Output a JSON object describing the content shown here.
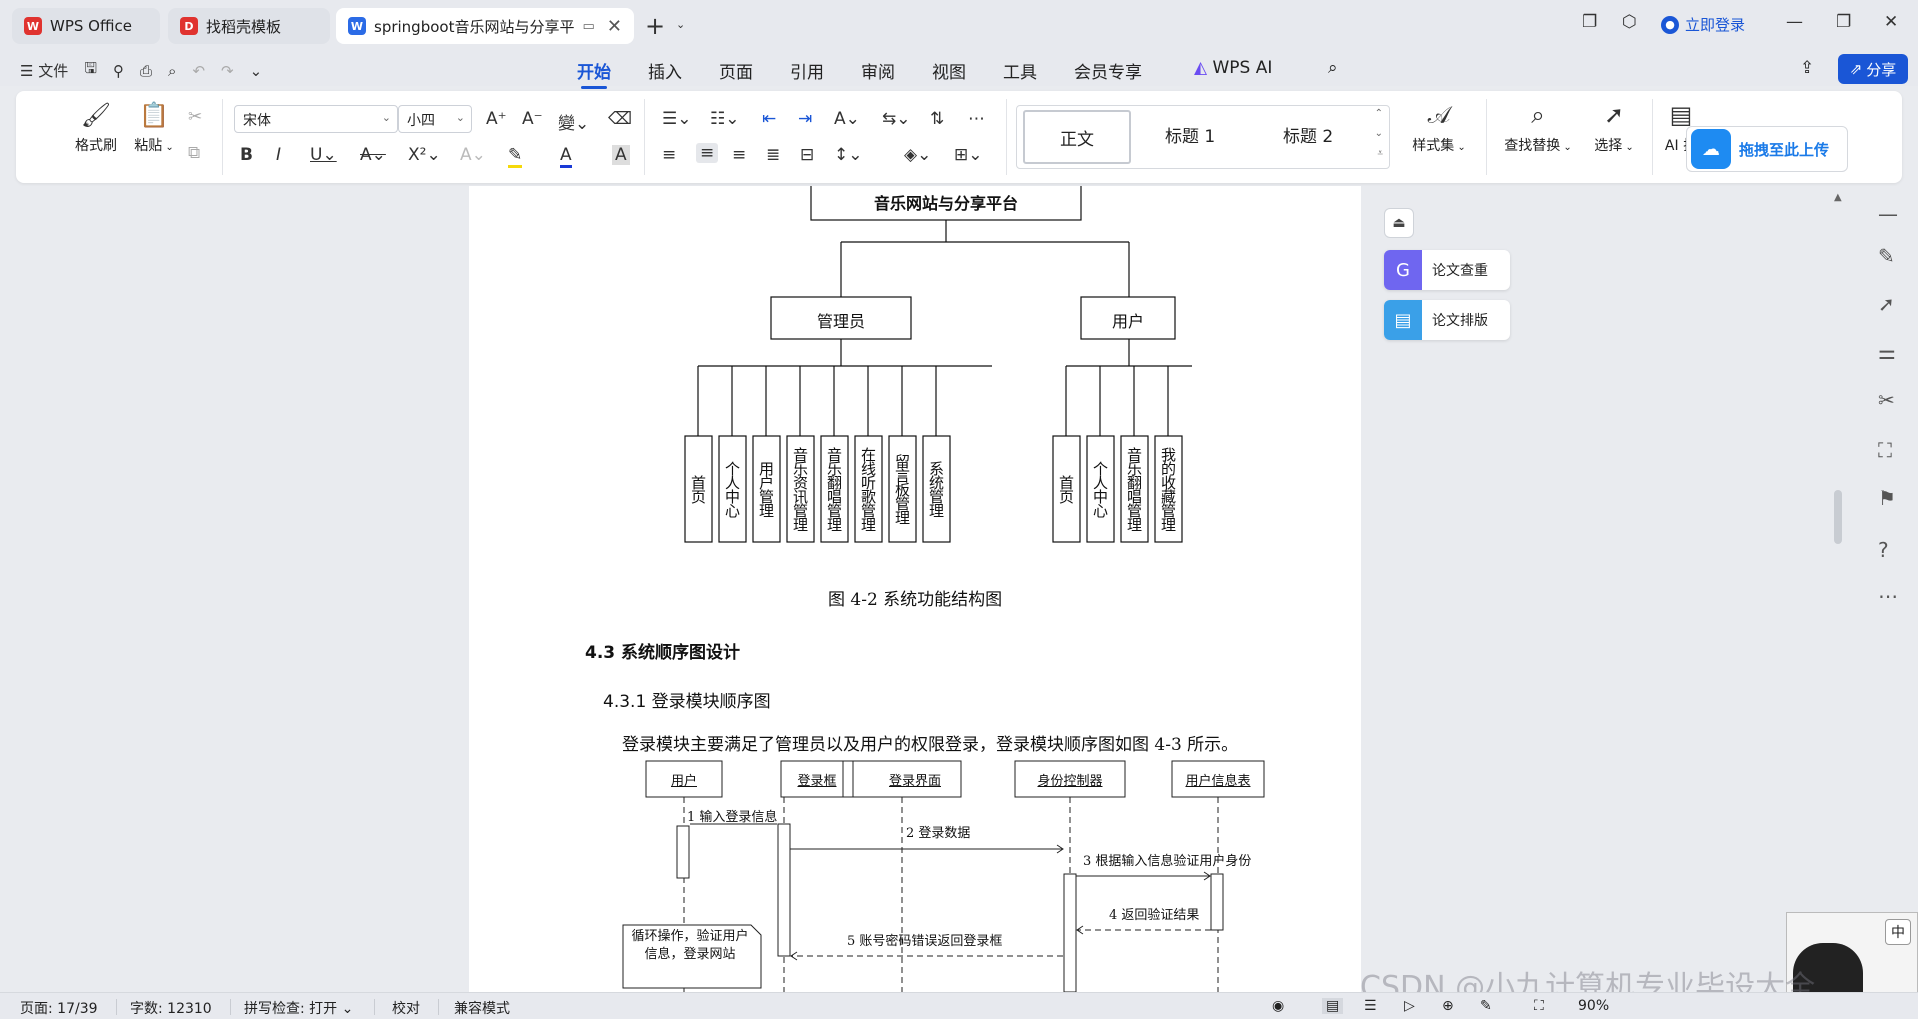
{
  "tabs": [
    {
      "label": "WPS Office",
      "icon": "wps-logo-icon",
      "color": "#e0332f"
    },
    {
      "label": "找稻壳模板",
      "icon": "docer-logo-icon",
      "color": "#e0332f"
    },
    {
      "label": "springboot音乐网站与分享平",
      "icon": "word-doc-icon",
      "color": "#2b6be6"
    }
  ],
  "titlebar": {
    "login_label": "立即登录"
  },
  "menu": {
    "file_label": "文件",
    "tabs": [
      "开始",
      "插入",
      "页面",
      "引用",
      "审阅",
      "视图",
      "工具",
      "会员专享",
      "WPS AI"
    ],
    "active_tab": "开始",
    "share_label": "分享"
  },
  "ribbon": {
    "format_painter": "格式刷",
    "paste": "粘贴",
    "font_name": "宋体",
    "font_size": "小四",
    "styles": [
      "正文",
      "标题 1",
      "标题 2"
    ],
    "style_set": "样式集",
    "find_replace": "查找替换",
    "select": "选择",
    "ai_layout": "AI 排",
    "upload_tip": "拖拽至此上传"
  },
  "side_panel": {
    "paper_check": "论文查重",
    "paper_layout": "论文排版"
  },
  "document": {
    "diagram_root": "音乐网站与分享平台",
    "admin_label": "管理员",
    "user_label": "用户",
    "admin_modules": [
      "首页",
      "个人中心",
      "用户管理",
      "音乐资讯管理",
      "音乐翻唱管理",
      "在线听歌管理",
      "留言板管理",
      "系统管理"
    ],
    "user_modules": [
      "首页",
      "个人中心",
      "音乐翻唱管理",
      "我的收藏管理"
    ],
    "figure_caption": "图 4-2 系统功能结构图",
    "section_heading": "4.3 系统顺序图设计",
    "subsection_heading": "4.3.1 登录模块顺序图",
    "paragraph": "登录模块主要满足了管理员以及用户的权限登录，登录模块顺序图如图 4-3 所示。",
    "seq_actors": [
      "用户",
      "登录框",
      "登录界面",
      "身份控制器",
      "用户信息表"
    ],
    "seq_messages": [
      "1 输入登录信息",
      "2 登录数据",
      "3 根据输入信息验证用户身份",
      "4 返回验证结果",
      "5 账号密码错误返回登录框"
    ],
    "seq_note": "循环操作，验证用户信息，登录网站"
  },
  "statusbar": {
    "page": "页面: 17/39",
    "word_count": "字数: 12310",
    "spell_check": "拼写检查: 打开",
    "proofread": "校对",
    "compat_mode": "兼容模式",
    "zoom": "90%"
  },
  "watermark": "CSDN @小九计算机专业毕设大全",
  "ime_indicator": "中"
}
